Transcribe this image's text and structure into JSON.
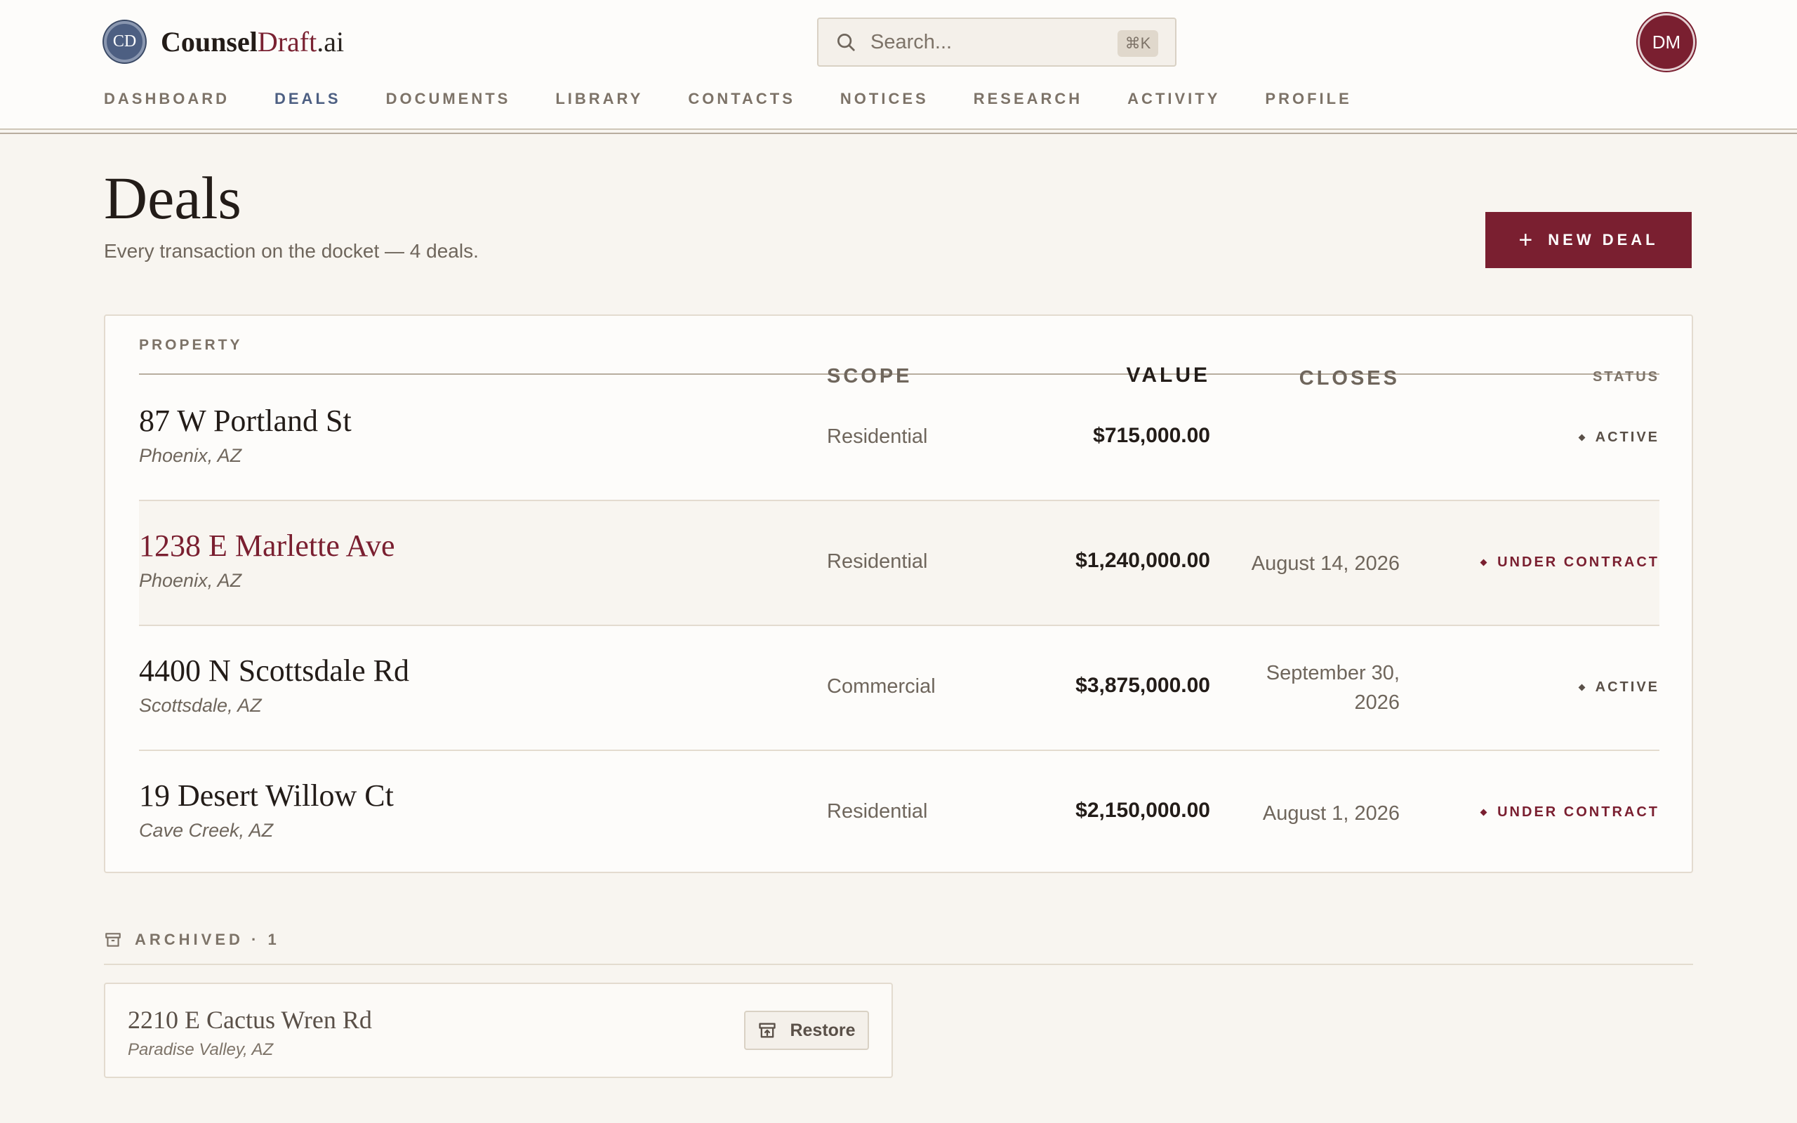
{
  "app": {
    "logo_initials": "CD",
    "logo_part1": "Counsel",
    "logo_part2": "Draft",
    "logo_part3": ".ai"
  },
  "search": {
    "placeholder": "Search...",
    "shortcut": "⌘K"
  },
  "user": {
    "initials": "DM"
  },
  "nav": {
    "items": [
      {
        "label": "DASHBOARD"
      },
      {
        "label": "DEALS",
        "active": true
      },
      {
        "label": "DOCUMENTS"
      },
      {
        "label": "LIBRARY"
      },
      {
        "label": "CONTACTS"
      },
      {
        "label": "NOTICES"
      },
      {
        "label": "RESEARCH"
      },
      {
        "label": "ACTIVITY"
      },
      {
        "label": "PROFILE"
      }
    ]
  },
  "page": {
    "title": "Deals",
    "subtitle": "Every transaction on the docket — 4 deals.",
    "new_deal_label": "NEW DEAL"
  },
  "table": {
    "headers": {
      "property": "PROPERTY",
      "scope": "SCOPE",
      "value": "VALUE",
      "closes": "CLOSES",
      "status": "STATUS"
    },
    "rows": [
      {
        "address": "87 W Portland St",
        "city": "Phoenix, AZ",
        "scope": "Residential",
        "value": "$715,000.00",
        "closes": "",
        "status": "ACTIVE"
      },
      {
        "address": "1238 E Marlette Ave",
        "city": "Phoenix, AZ",
        "scope": "Residential",
        "value": "$1,240,000.00",
        "closes": "August 14, 2026",
        "status": "UNDER CONTRACT"
      },
      {
        "address": "4400 N Scottsdale Rd",
        "city": "Scottsdale, AZ",
        "scope": "Commercial",
        "value": "$3,875,000.00",
        "closes": "September 30, 2026",
        "status": "ACTIVE"
      },
      {
        "address": "19 Desert Willow Ct",
        "city": "Cave Creek, AZ",
        "scope": "Residential",
        "value": "$2,150,000.00",
        "closes": "August 1, 2026",
        "status": "UNDER CONTRACT"
      }
    ]
  },
  "archived": {
    "label": "ARCHIVED · 1",
    "items": [
      {
        "address": "2210 E Cactus Wren Rd",
        "city": "Paradise Valley, AZ",
        "action": "Restore"
      }
    ]
  },
  "colors": {
    "accent": "#7a1f30",
    "nav_active": "#4d5f82",
    "background": "#f8f5f0"
  },
  "icons": {
    "search": "search-icon",
    "plus": "plus-icon",
    "archive": "archive-icon",
    "restore": "restore-icon"
  }
}
